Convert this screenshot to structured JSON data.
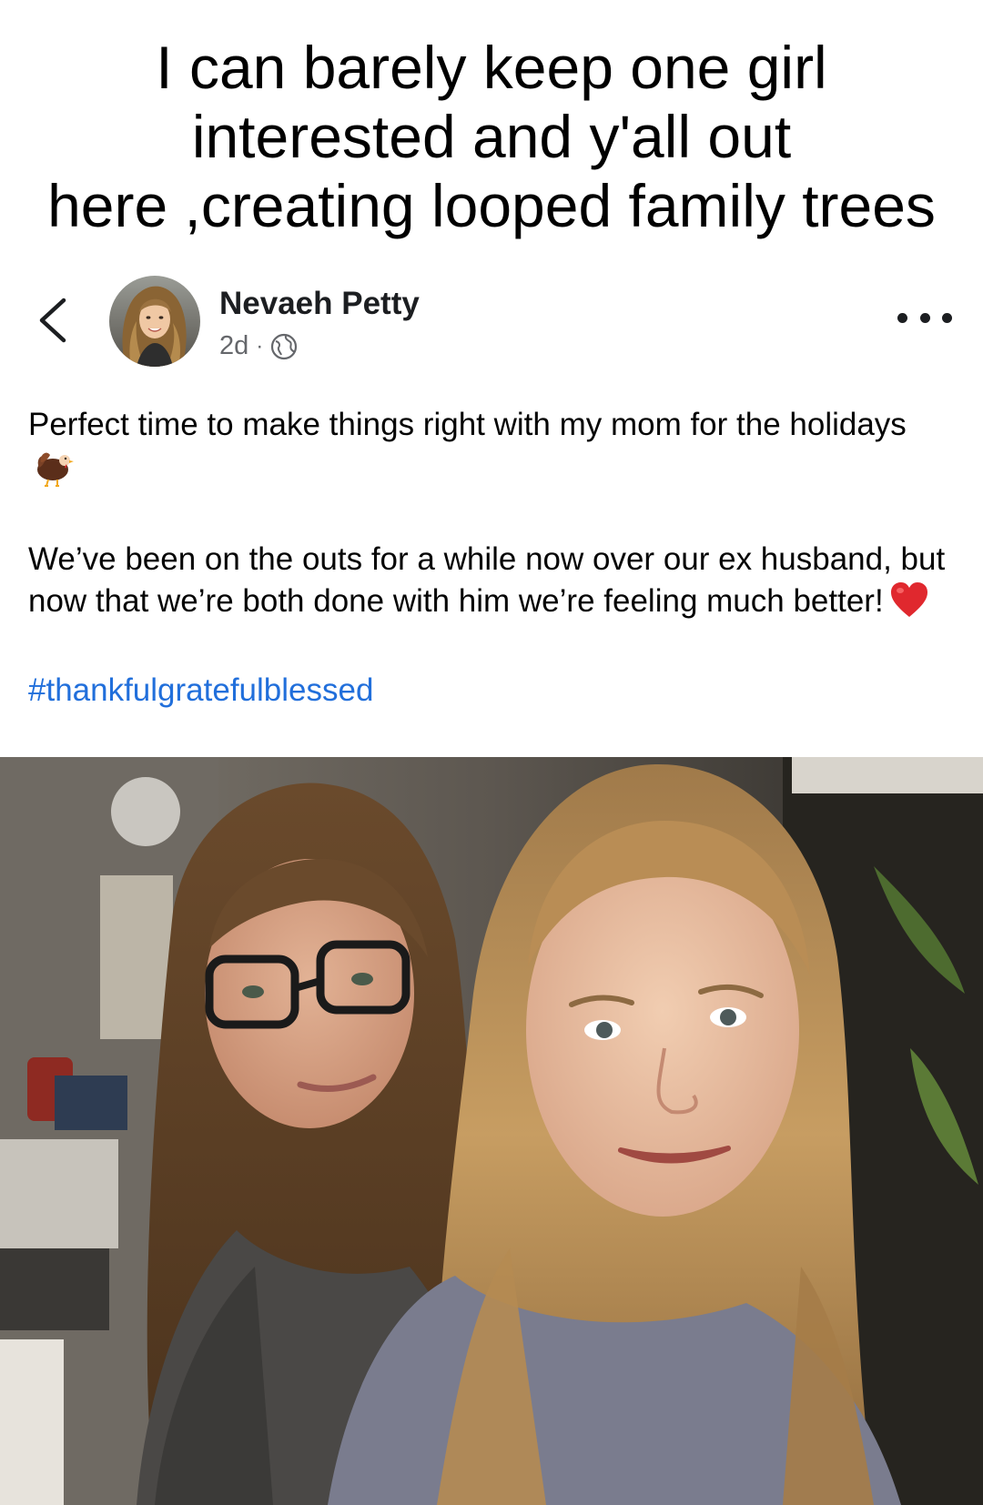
{
  "meme_caption": "I can barely keep one girl\ninterested and y'all out\nhere ,creating looped family trees",
  "post": {
    "author_name": "Nevaeh Petty",
    "time_ago": "2d",
    "meta_separator": "·",
    "privacy_icon": "globe-icon",
    "back_icon": "chevron-left-icon",
    "more_icon": "more-options-icon",
    "text_paragraph_1": "Perfect time to make things right with my mom for the holidays",
    "paragraph_1_emoji": "turkey-emoji",
    "text_paragraph_2": "We’ve been on the outs for a while now over our ex husband, but now that we’re both done with him we’re feeling much better!",
    "paragraph_2_emoji": "red-heart-emoji",
    "hashtag": "#thankfulgratefulblessed"
  },
  "colors": {
    "hashtag": "#216fdb",
    "meta_gray": "#65676b",
    "name_text": "#1c1e21",
    "body_text": "#050505"
  }
}
